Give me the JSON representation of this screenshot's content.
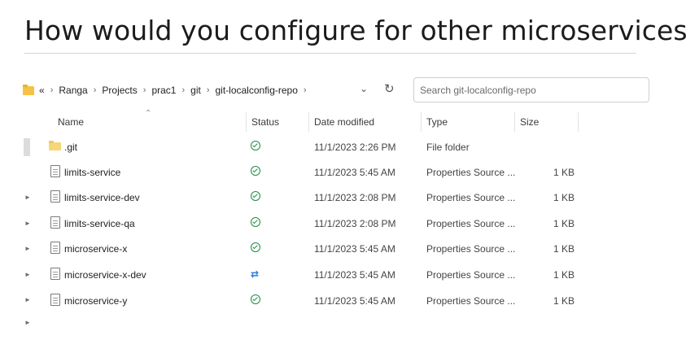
{
  "heading": "How would you configure for other microservices.",
  "address_bar": {
    "overflow": "«",
    "breadcrumbs": [
      "Ranga",
      "Projects",
      "prac1",
      "git",
      "git-localconfig-repo"
    ],
    "dropdown_icon": "chevron-down-icon",
    "refresh_icon": "refresh-icon"
  },
  "search": {
    "placeholder": "Search git-localconfig-repo"
  },
  "columns": {
    "name": "Name",
    "status": "Status",
    "date": "Date modified",
    "type": "Type",
    "size": "Size"
  },
  "rows": [
    {
      "name": ".git",
      "status": "synced",
      "date": "11/1/2023 2:26 PM",
      "type": "File folder",
      "size": ""
    },
    {
      "name": "limits-service",
      "status": "synced",
      "date": "11/1/2023 5:45 AM",
      "type": "Properties Source ...",
      "size": "1 KB"
    },
    {
      "name": "limits-service-dev",
      "status": "synced",
      "date": "11/1/2023 2:08 PM",
      "type": "Properties Source ...",
      "size": "1 KB"
    },
    {
      "name": "limits-service-qa",
      "status": "synced",
      "date": "11/1/2023 2:08 PM",
      "type": "Properties Source ...",
      "size": "1 KB"
    },
    {
      "name": "microservice-x",
      "status": "synced",
      "date": "11/1/2023 5:45 AM",
      "type": "Properties Source ...",
      "size": "1 KB"
    },
    {
      "name": "microservice-x-dev",
      "status": "syncing",
      "date": "11/1/2023 5:45 AM",
      "type": "Properties Source ...",
      "size": "1 KB"
    },
    {
      "name": "microservice-y",
      "status": "synced",
      "date": "11/1/2023 5:45 AM",
      "type": "Properties Source ...",
      "size": "1 KB"
    }
  ],
  "colors": {
    "synced": "#1e8a43",
    "syncing": "#2f7bd6",
    "folder": "#f5c344"
  }
}
